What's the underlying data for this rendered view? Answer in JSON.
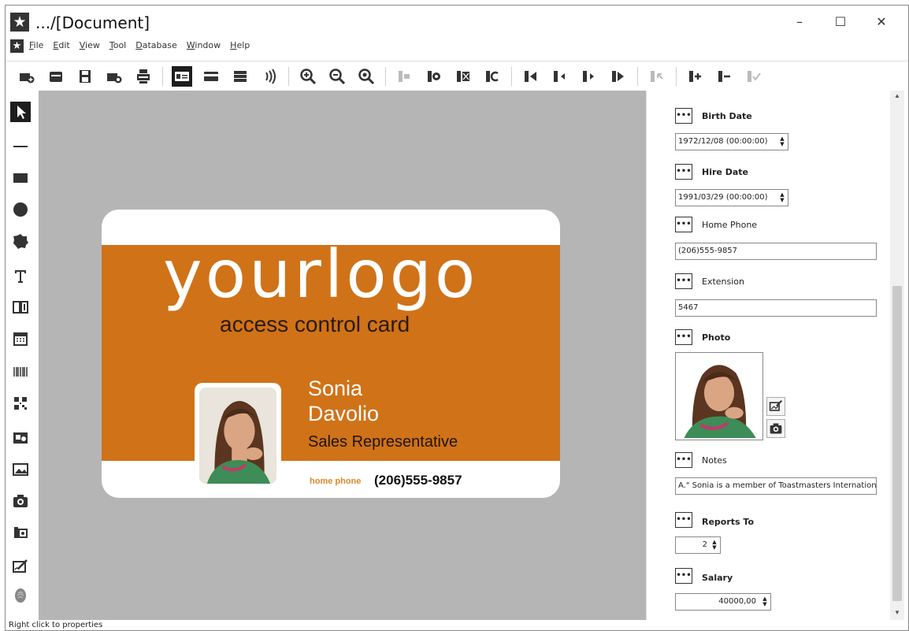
{
  "window": {
    "title": ".../[Document]",
    "controls": {
      "minimize": "–",
      "maximize": "☐",
      "close": "✕"
    }
  },
  "menu": [
    {
      "label": "File",
      "accel": "F",
      "rest": "ile"
    },
    {
      "label": "Edit",
      "accel": "E",
      "rest": "dit"
    },
    {
      "label": "View",
      "accel": "V",
      "rest": "iew"
    },
    {
      "label": "Tool",
      "accel": "T",
      "rest": "ool"
    },
    {
      "label": "Database",
      "accel": "D",
      "rest": "atabase"
    },
    {
      "label": "Window",
      "accel": "W",
      "rest": "indow"
    },
    {
      "label": "Help",
      "accel": "H",
      "rest": "elp"
    }
  ],
  "toolbar": {
    "icons": [
      "new-card-icon",
      "open-icon",
      "save-icon",
      "save-as-icon",
      "print-icon",
      "card-front-icon",
      "card-back-icon",
      "records-icon",
      "encode-icon",
      "zoom-in-icon",
      "zoom-out-icon",
      "zoom-fit-icon",
      "align-left-icon",
      "align-center-icon",
      "align-right-icon",
      "align-justify-icon",
      "move-first-icon",
      "move-prev-icon",
      "move-next-icon",
      "move-last-icon",
      "undo-icon",
      "add-record-icon",
      "delete-record-icon",
      "confirm-icon"
    ]
  },
  "tools": [
    "pointer-tool-icon",
    "line-tool-icon",
    "rectangle-tool-icon",
    "ellipse-tool-icon",
    "polygon-tool-icon",
    "text-tool-icon",
    "counter-tool-icon",
    "date-tool-icon",
    "barcode-tool-icon",
    "qrcode-tool-icon",
    "image-field-tool-icon",
    "picture-tool-icon",
    "camera-tool-icon",
    "photo-field-tool-icon",
    "signature-tool-icon",
    "fingerprint-tool-icon"
  ],
  "card": {
    "logo_text": "yourlogo",
    "tagline": "access control card",
    "first_name": "Sonia",
    "last_name": "Davolio",
    "job_title": "Sales Representative",
    "phone_label": "home phone",
    "phone_value": "(206)555-9857",
    "colors": {
      "band": "#d07218",
      "card": "#ffffff",
      "canvas": "#b5b5b5"
    }
  },
  "properties": {
    "birth_date": {
      "label": "Birth Date",
      "value": "1972/12/08 (00:00:00)"
    },
    "hire_date": {
      "label": "Hire Date",
      "value": "1991/03/29 (00:00:00)"
    },
    "home_phone": {
      "label": "Home Phone",
      "value": "(206)555-9857"
    },
    "extension": {
      "label": "Extension",
      "value": "5467"
    },
    "photo": {
      "label": "Photo"
    },
    "notes": {
      "label": "Notes",
      "value": "A.\"  Sonia is a member of Toastmasters International."
    },
    "reports_to": {
      "label": "Reports To",
      "value": "2"
    },
    "salary": {
      "label": "Salary",
      "value": "40000,00"
    },
    "button_text": "•••"
  },
  "status": {
    "text": "Right click to properties"
  }
}
